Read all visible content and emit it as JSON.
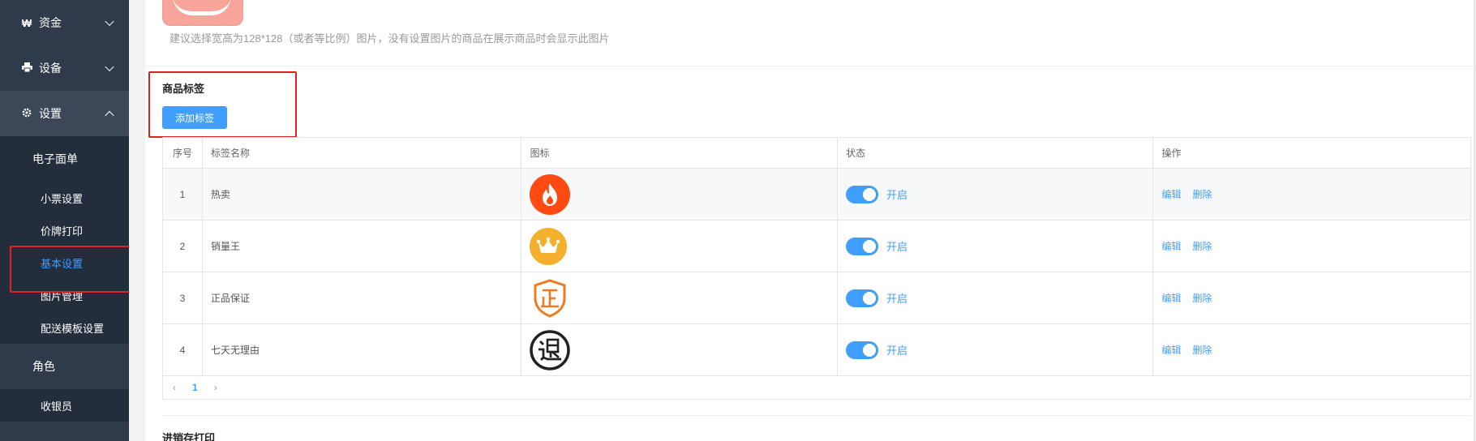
{
  "sidebar": {
    "funds": {
      "icon": "₩",
      "label": "资金"
    },
    "device": {
      "label": "设备"
    },
    "settings": {
      "label": "设置"
    },
    "sub": {
      "group_label": "电子面单",
      "items": [
        "小票设置",
        "价牌打印",
        "基本设置",
        "图片管理",
        "配送模板设置"
      ],
      "active": "基本设置"
    },
    "role": {
      "label": "角色",
      "items": [
        "收银员"
      ]
    }
  },
  "main": {
    "image_hint": "建议选择宽高为128*128（或者等比例）图片，没有设置图片的商品在展示商品时会显示此图片",
    "section_title": "商品标签",
    "add_button": "添加标签",
    "table": {
      "headers": [
        "序号",
        "标签名称",
        "图标",
        "状态",
        "操作"
      ],
      "rows": [
        {
          "no": "1",
          "name": "热卖",
          "icon": "fire-icon",
          "status": "开启",
          "edit": "编辑",
          "delete": "删除"
        },
        {
          "no": "2",
          "name": "销量王",
          "icon": "crown-icon",
          "status": "开启",
          "edit": "编辑",
          "delete": "删除"
        },
        {
          "no": "3",
          "name": "正品保证",
          "icon": "authentic-shield-icon",
          "status": "开启",
          "edit": "编辑",
          "delete": "删除"
        },
        {
          "no": "4",
          "name": "七天无理由",
          "icon": "return-icon",
          "status": "开启",
          "edit": "编辑",
          "delete": "删除"
        }
      ]
    },
    "pager": {
      "prev": "‹",
      "current": "1",
      "next": "›"
    },
    "section2_title": "进销存打印"
  },
  "colors": {
    "sidebar": "#2f3a4a",
    "accent": "#409eff",
    "highlight": "#e02020"
  }
}
